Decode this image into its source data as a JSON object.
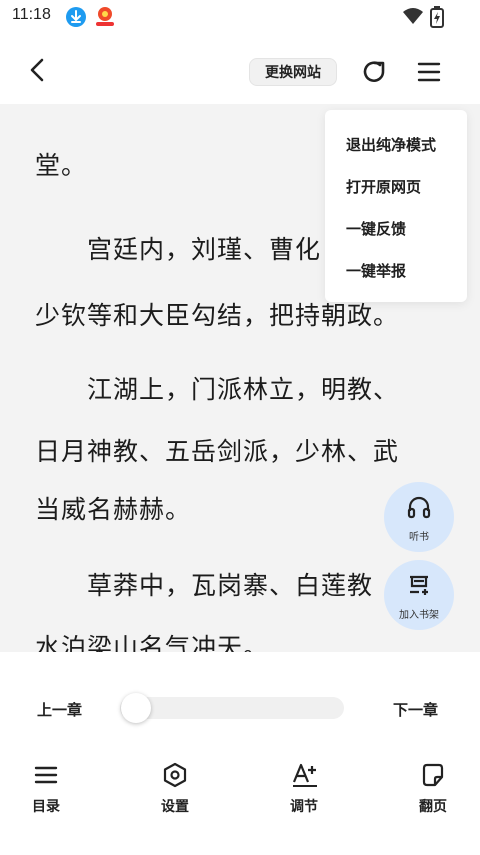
{
  "status_bar": {
    "time": "11:18"
  },
  "toolbar": {
    "switch_site_label": "更换网站"
  },
  "content": {
    "paragraphs": [
      "堂。",
      "　　宫廷内，刘瑾、曹化",
      "少钦等和大臣勾结，把持朝政。",
      "　　江湖上，门派林立，明教、",
      "日月神教、五岳剑派，少林、武",
      "当威名赫赫。",
      "　　草莽中，瓦岗寨、白莲教",
      "水泊梁山名气冲天。"
    ]
  },
  "popup_menu": {
    "items": [
      {
        "label": "退出纯净模式"
      },
      {
        "label": "打开原网页"
      },
      {
        "label": "一键反馈"
      },
      {
        "label": "一键举报"
      }
    ]
  },
  "floating": {
    "listen_label": "听书",
    "add_shelf_label": "加入书架"
  },
  "chapter_nav": {
    "prev_label": "上一章",
    "next_label": "下一章",
    "progress": 0.0
  },
  "bottom_nav": {
    "items": [
      {
        "label": "目录",
        "icon": "list-icon"
      },
      {
        "label": "设置",
        "icon": "settings-hexagon-icon"
      },
      {
        "label": "调节",
        "icon": "text-size-icon"
      },
      {
        "label": "翻页",
        "icon": "page-flip-icon"
      }
    ]
  },
  "colors": {
    "accent_fab": "#d7e7fb",
    "download_badge": "#1e9bf0"
  }
}
